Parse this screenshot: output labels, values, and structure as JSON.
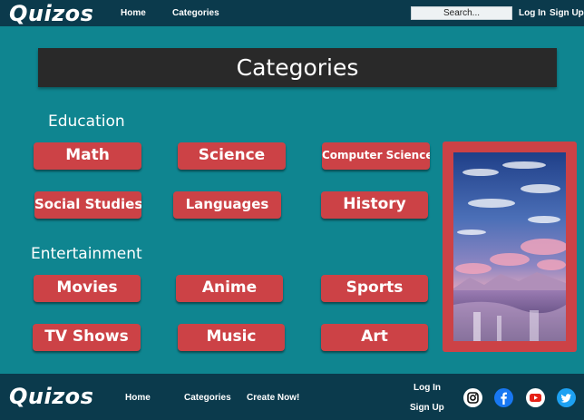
{
  "header": {
    "logo": "Quizos",
    "nav": {
      "home": "Home",
      "categories": "Categories"
    },
    "search_placeholder": "Search...",
    "auth": {
      "login": "Log In",
      "signup": "Sign Up"
    }
  },
  "page_title": "Categories",
  "sections": {
    "education": "Education",
    "entertainment": "Entertainment"
  },
  "categories": {
    "math": "Math",
    "science": "Science",
    "computer_science": "Computer Science",
    "social_studies": "Social Studies",
    "languages": "Languages",
    "history": "History",
    "movies": "Movies",
    "anime": "Anime",
    "sports": "Sports",
    "tv_shows": "TV Shows",
    "music": "Music",
    "art": "Art"
  },
  "footer": {
    "logo": "Quizos",
    "nav": {
      "home": "Home",
      "categories": "Categories",
      "create": "Create Now!"
    },
    "auth": {
      "login": "Log In",
      "signup": "Sign Up"
    },
    "social_icons": [
      "instagram-icon",
      "facebook-icon",
      "youtube-icon",
      "twitter-icon"
    ]
  },
  "colors": {
    "nav_bg": "#0b3a4c",
    "page_bg": "#0f8590",
    "accent": "#cc4246",
    "banner_bg": "#292929"
  }
}
